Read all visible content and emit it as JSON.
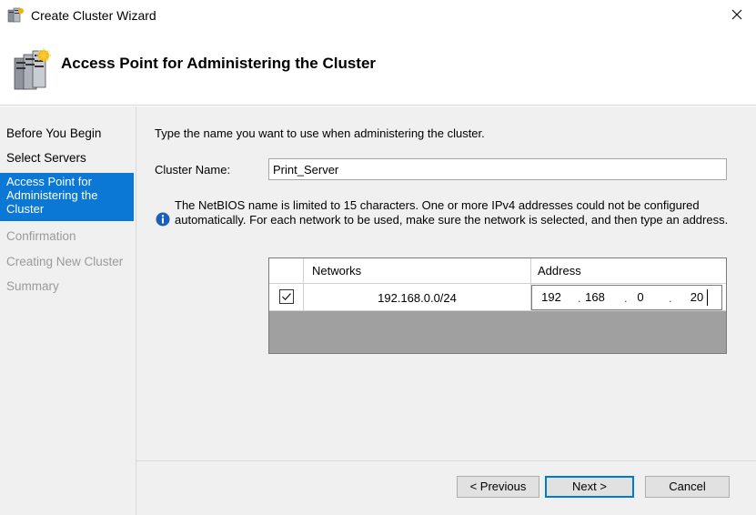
{
  "window": {
    "title": "Create Cluster Wizard",
    "app_icon": "cluster-server-icon",
    "close_icon": "close-icon"
  },
  "header": {
    "icon": "cluster-servers-icon",
    "title": "Access Point for Administering the Cluster"
  },
  "steps": [
    {
      "label": "Before You Begin",
      "state": "normal"
    },
    {
      "label": "Select Servers",
      "state": "normal"
    },
    {
      "label": "Access Point for Administering the Cluster",
      "state": "selected"
    },
    {
      "label": "Confirmation",
      "state": "disabled"
    },
    {
      "label": "Creating New Cluster",
      "state": "disabled"
    },
    {
      "label": "Summary",
      "state": "disabled"
    }
  ],
  "main": {
    "intro": "Type the name you want to use when administering the cluster.",
    "cluster_name_label": "Cluster Name:",
    "cluster_name_value": "Print_Server",
    "info_icon": "info-icon",
    "info_text": "The NetBIOS name is limited to 15 characters.  One or more IPv4 addresses could not be configured automatically.  For each network to be used, make sure the network is selected, and then type an address."
  },
  "grid": {
    "headers": {
      "networks": "Networks",
      "address": "Address"
    },
    "rows": [
      {
        "checked": true,
        "network": "192.168.0.0/24",
        "address_octets": [
          "192",
          "168",
          "0",
          "20"
        ]
      }
    ]
  },
  "buttons": {
    "previous": "< Previous",
    "next": "Next >",
    "cancel": "Cancel"
  },
  "colors": {
    "accent": "#0a78d4",
    "panel": "#f0f0f0",
    "grid_empty": "#a0a0a0"
  }
}
